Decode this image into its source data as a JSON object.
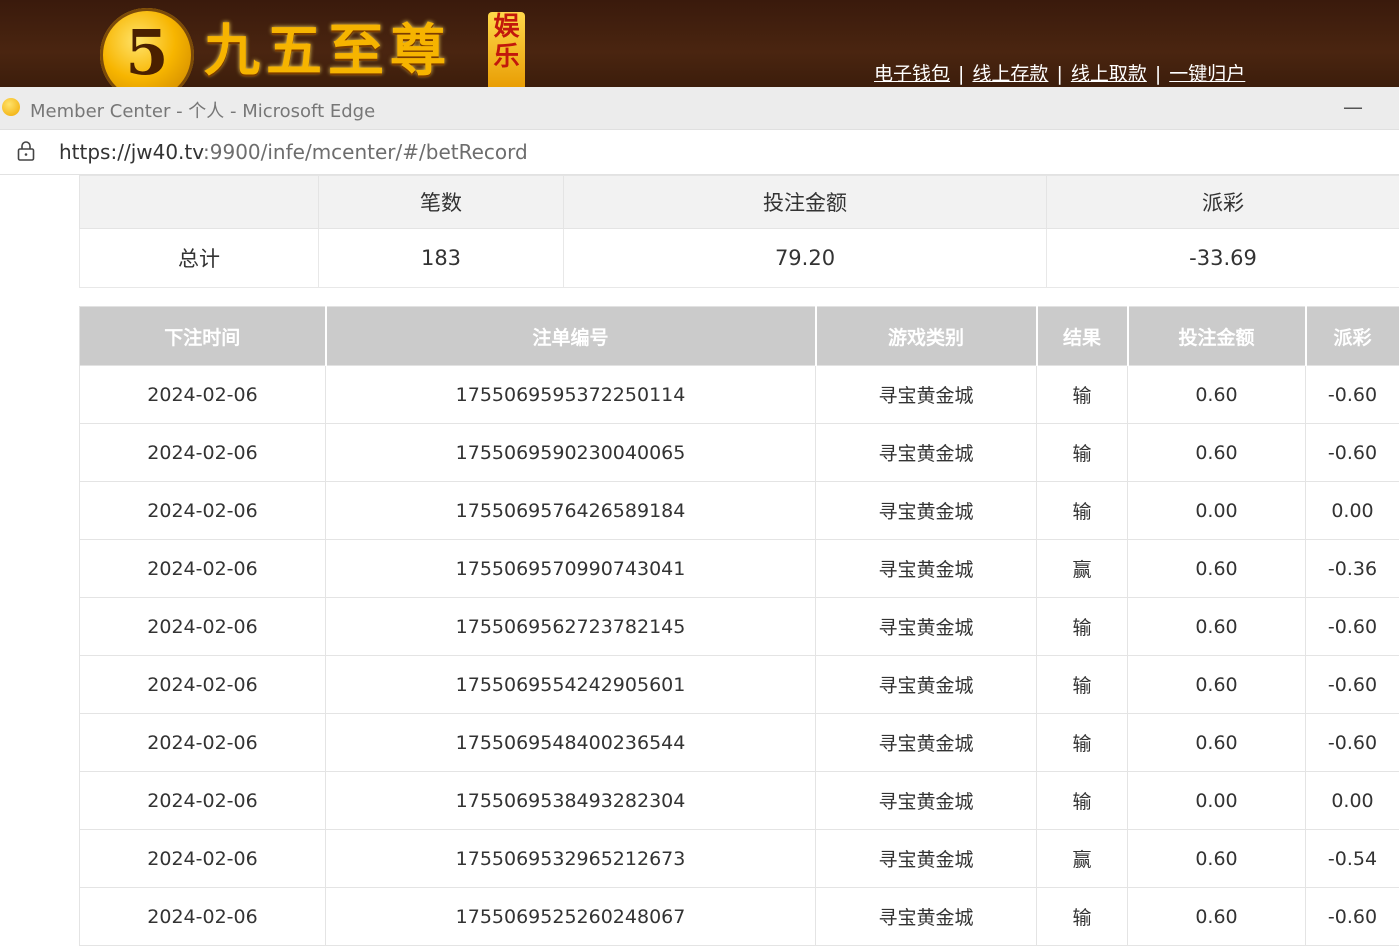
{
  "site": {
    "logo_digit": "5",
    "logo_text": "九五至尊",
    "logo_badge": [
      "娱",
      "乐"
    ],
    "nav": [
      "电子钱包",
      "线上存款",
      "线上取款",
      "一键归户"
    ],
    "nav_separator": "|"
  },
  "window": {
    "title": "Member Center - 个人 - Microsoft Edge",
    "minimize": "—"
  },
  "address": {
    "url_prefix": "https://jw40.tv",
    "url_suffix": ":9900/infe/mcenter/#/betRecord"
  },
  "summary": {
    "headers": [
      "",
      "笔数",
      "投注金额",
      "派彩"
    ],
    "row": {
      "label": "总计",
      "count": "183",
      "amount": "79.20",
      "payout": "-33.69"
    }
  },
  "records": {
    "headers": [
      "下注时间",
      "注单编号",
      "游戏类别",
      "结果",
      "投注金额",
      "派彩"
    ],
    "rows": [
      {
        "date": "2024-02-06",
        "id": "1755069595372250114",
        "game": "寻宝黄金城",
        "result": "输",
        "amount": "0.60",
        "payout": "-0.60"
      },
      {
        "date": "2024-02-06",
        "id": "1755069590230040065",
        "game": "寻宝黄金城",
        "result": "输",
        "amount": "0.60",
        "payout": "-0.60"
      },
      {
        "date": "2024-02-06",
        "id": "1755069576426589184",
        "game": "寻宝黄金城",
        "result": "输",
        "amount": "0.00",
        "payout": "0.00"
      },
      {
        "date": "2024-02-06",
        "id": "1755069570990743041",
        "game": "寻宝黄金城",
        "result": "赢",
        "amount": "0.60",
        "payout": "-0.36"
      },
      {
        "date": "2024-02-06",
        "id": "1755069562723782145",
        "game": "寻宝黄金城",
        "result": "输",
        "amount": "0.60",
        "payout": "-0.60"
      },
      {
        "date": "2024-02-06",
        "id": "1755069554242905601",
        "game": "寻宝黄金城",
        "result": "输",
        "amount": "0.60",
        "payout": "-0.60"
      },
      {
        "date": "2024-02-06",
        "id": "1755069548400236544",
        "game": "寻宝黄金城",
        "result": "输",
        "amount": "0.60",
        "payout": "-0.60"
      },
      {
        "date": "2024-02-06",
        "id": "1755069538493282304",
        "game": "寻宝黄金城",
        "result": "输",
        "amount": "0.00",
        "payout": "0.00"
      },
      {
        "date": "2024-02-06",
        "id": "1755069532965212673",
        "game": "寻宝黄金城",
        "result": "赢",
        "amount": "0.60",
        "payout": "-0.54"
      },
      {
        "date": "2024-02-06",
        "id": "1755069525260248067",
        "game": "寻宝黄金城",
        "result": "输",
        "amount": "0.60",
        "payout": "-0.60"
      }
    ]
  },
  "colors": {
    "negative": "#e8343f",
    "header_bg": "#cbcbcb",
    "brand_gold": "#f6b400"
  }
}
